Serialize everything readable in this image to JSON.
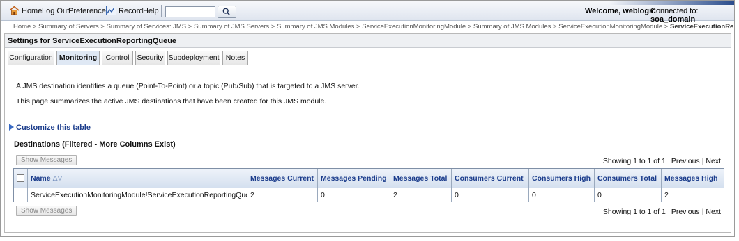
{
  "toolbar": {
    "home": "Home",
    "logout": "Log Out",
    "preferences": "Preferences",
    "record": "Record",
    "help": "Help",
    "search_value": "",
    "welcome": "Welcome, weblogic",
    "connected_label": "Connected to:",
    "connected_value": "soa_domain"
  },
  "breadcrumb": {
    "items": [
      "Home >",
      "Summary of Servers >",
      "Summary of Services: JMS >",
      "Summary of JMS Servers >",
      "Summary of JMS Modules >",
      "ServiceExecutionMonitoringModule >",
      "Summary of JMS Modules >",
      "ServiceExecutionMonitoringModule >"
    ],
    "current": "ServiceExecutionReportingQueue"
  },
  "panel": {
    "title": "Settings for ServiceExecutionReportingQueue",
    "tabs": [
      "Configuration",
      "Monitoring",
      "Control",
      "Security",
      "Subdeployment",
      "Notes"
    ],
    "active_tab": "Monitoring",
    "desc1": "A JMS destination identifies a queue (Point-To-Point) or a topic (Pub/Sub) that is targeted to a JMS server.",
    "desc2": "This page summarizes the active JMS destinations that have been created for this JMS module.",
    "customize": "Customize this table",
    "table_title": "Destinations (Filtered - More Columns Exist)",
    "show_messages": "Show Messages",
    "paging": {
      "showing": "Showing 1 to 1 of 1",
      "previous": "Previous",
      "separator": "|",
      "next": "Next"
    }
  },
  "table": {
    "columns": [
      "Name",
      "Messages Current",
      "Messages Pending",
      "Messages Total",
      "Consumers Current",
      "Consumers High",
      "Consumers Total",
      "Messages High"
    ],
    "rows": [
      [
        "ServiceExecutionMonitoringModule!ServiceExecutionReportingQueue",
        "2",
        "0",
        "2",
        "0",
        "0",
        "0",
        "2"
      ]
    ]
  }
}
